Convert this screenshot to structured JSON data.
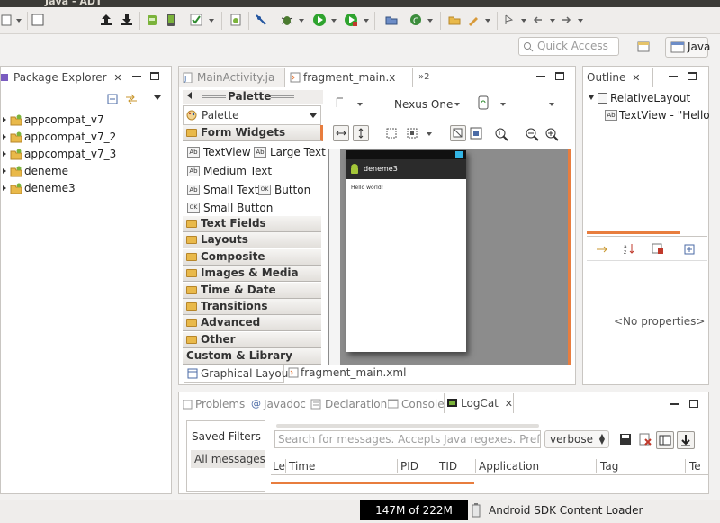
{
  "window": {
    "title": "Java - ADT"
  },
  "toolbar": {
    "quick_access_placeholder": "Quick Access",
    "perspective_label": "Java"
  },
  "package_explorer": {
    "title": "Package Explorer",
    "projects": [
      "appcompat_v7",
      "appcompat_v7_2",
      "appcompat_v7_3",
      "deneme",
      "deneme3"
    ]
  },
  "editor": {
    "tabs": [
      {
        "label": "MainActivity.ja",
        "active": false
      },
      {
        "label": "fragment_main.x",
        "active": true
      }
    ],
    "overflow_label": "»2",
    "palette": {
      "header": "Palette",
      "selector": "Palette",
      "form_widgets_label": "Form Widgets",
      "widgets": {
        "textview": "TextView",
        "large_text": "Large Text",
        "medium_text": "Medium Text",
        "small_text": "Small Text",
        "button": "Button",
        "small_button": "Small Button"
      },
      "categories": [
        "Text Fields",
        "Layouts",
        "Composite",
        "Images & Media",
        "Time & Date",
        "Transitions",
        "Advanced",
        "Other",
        "Custom & Library Views"
      ]
    },
    "device": "Nexus One",
    "preview": {
      "app_name": "deneme3",
      "content_text": "Hello world!"
    },
    "bottom_tabs": [
      {
        "label": "Graphical Layout",
        "active": true
      },
      {
        "label": "fragment_main.xml",
        "active": false
      }
    ]
  },
  "outline": {
    "title": "Outline",
    "root": "RelativeLayout",
    "child": "TextView - \"Hello w",
    "no_properties": "<No properties>"
  },
  "bottom_panel": {
    "tabs": [
      "Problems",
      "Javadoc",
      "Declaration",
      "Console",
      "LogCat"
    ],
    "saved_filters_label": "Saved Filters",
    "all_messages_label": "All messages (",
    "search_placeholder": "Search for messages. Accepts Java regexes. Prefix with",
    "log_level": "verbose",
    "columns": [
      "Le",
      "Time",
      "PID",
      "TID",
      "Application",
      "Tag",
      "Te"
    ]
  },
  "status": {
    "heap_label": "147M of 222M",
    "heap_used_fraction": 0.66,
    "task_label": "Android SDK Content Loader"
  },
  "colors": {
    "accent": "#e87d3e",
    "preview_bg": "#8c8c8c",
    "app_bar": "#2b2b2b"
  }
}
